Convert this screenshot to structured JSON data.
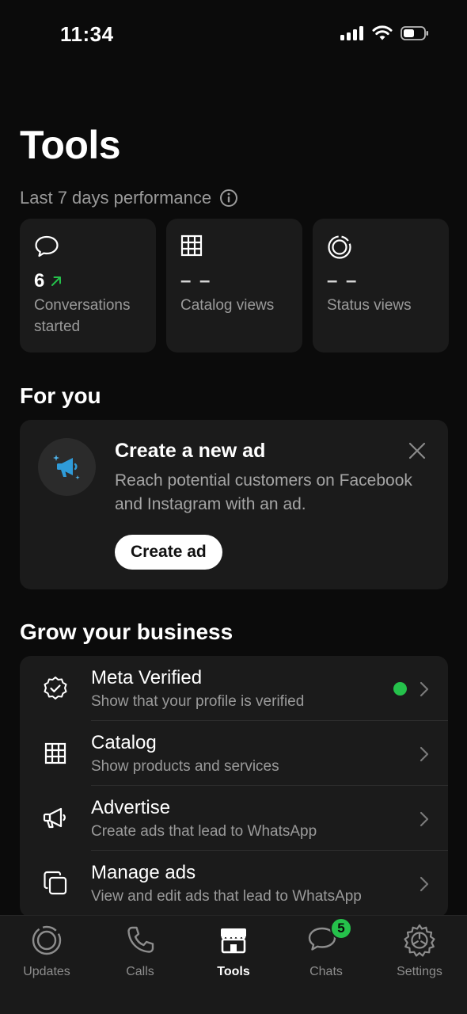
{
  "status_bar": {
    "time": "11:34"
  },
  "page": {
    "title": "Tools"
  },
  "performance": {
    "heading": "Last 7 days performance",
    "cards": [
      {
        "icon": "chat-bubble-icon",
        "value": "6",
        "trend": "up-arrow",
        "dash": "",
        "label": "Conversations started"
      },
      {
        "icon": "grid-icon",
        "value": "",
        "dash": "– –",
        "label": "Catalog views"
      },
      {
        "icon": "status-ring-icon",
        "value": "",
        "dash": "– –",
        "label": "Status views"
      }
    ]
  },
  "for_you": {
    "heading": "For you",
    "promo": {
      "icon": "megaphone-icon",
      "title": "Create a new ad",
      "text": "Reach potential customers on Facebook and Instagram with an ad.",
      "button": "Create ad"
    }
  },
  "grow": {
    "heading": "Grow your business",
    "items": [
      {
        "icon": "verified-badge-icon",
        "title": "Meta Verified",
        "subtitle": "Show that your profile is verified",
        "status_dot": true
      },
      {
        "icon": "grid-icon",
        "title": "Catalog",
        "subtitle": "Show products and services"
      },
      {
        "icon": "megaphone-icon",
        "title": "Advertise",
        "subtitle": "Create ads that lead to WhatsApp"
      },
      {
        "icon": "copy-icon",
        "title": "Manage ads",
        "subtitle": "View and edit ads that lead to WhatsApp"
      }
    ]
  },
  "tabs": [
    {
      "label": "Updates",
      "icon": "updates-icon",
      "active": false
    },
    {
      "label": "Calls",
      "icon": "phone-icon",
      "active": false
    },
    {
      "label": "Tools",
      "icon": "storefront-icon",
      "active": true
    },
    {
      "label": "Chats",
      "icon": "chats-icon",
      "active": false,
      "badge": "5"
    },
    {
      "label": "Settings",
      "icon": "gear-icon",
      "active": false
    }
  ],
  "colors": {
    "background": "#0b0b0b",
    "card": "#1b1b1b",
    "accent_green": "#25c14b",
    "megaphone_blue": "#2f9bd8"
  }
}
